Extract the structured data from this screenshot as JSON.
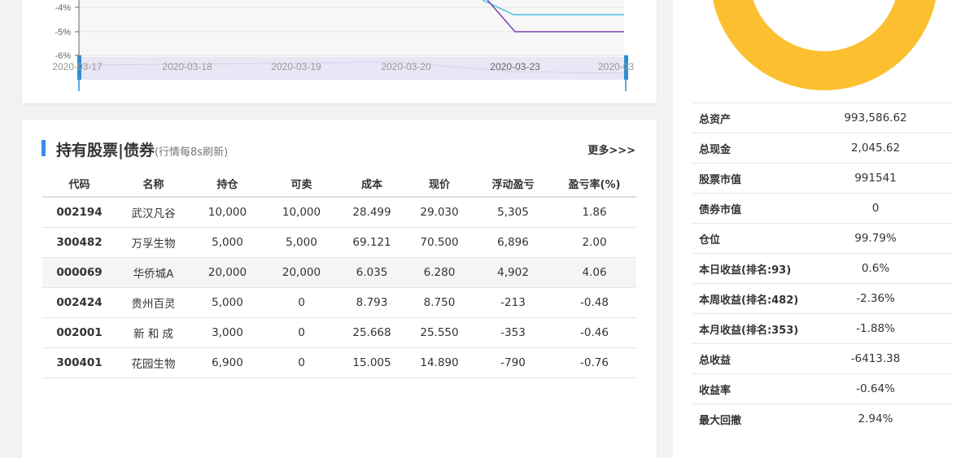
{
  "chart": {
    "y_ticks": [
      "-4%",
      "-5%",
      "-6%"
    ],
    "dates": [
      "2020-03-17",
      "2020-03-18",
      "2020-03-19",
      "2020-03-20",
      "2020-03-23",
      "2020-03"
    ],
    "colors": {
      "line_a": "#1fb8e0",
      "line_b": "#7e3fb0",
      "slider": "#e9e6f5",
      "handle": "#2a8fd4"
    }
  },
  "holdings": {
    "title": "持有股票|债券",
    "note": "(行情每8s刷新)",
    "more_label": "更多>>>",
    "columns": [
      "代码",
      "名称",
      "持仓",
      "可卖",
      "成本",
      "现价",
      "浮动盈亏",
      "盈亏率(%)"
    ],
    "rows": [
      [
        "002194",
        "武汉凡谷",
        "10,000",
        "10,000",
        "28.499",
        "29.030",
        "5,305",
        "1.86"
      ],
      [
        "300482",
        "万孚生物",
        "5,000",
        "5,000",
        "69.121",
        "70.500",
        "6,896",
        "2.00"
      ],
      [
        "000069",
        "华侨城A",
        "20,000",
        "20,000",
        "6.035",
        "6.280",
        "4,902",
        "4.06"
      ],
      [
        "002424",
        "贵州百灵",
        "5,000",
        "0",
        "8.793",
        "8.750",
        "-213",
        "-0.48"
      ],
      [
        "002001",
        "新 和 成",
        "3,000",
        "0",
        "25.668",
        "25.550",
        "-353",
        "-0.46"
      ],
      [
        "300401",
        "花园生物",
        "6,900",
        "0",
        "15.005",
        "14.890",
        "-790",
        "-0.76"
      ]
    ]
  },
  "account": {
    "donut_color": "#fbbf2f",
    "stats": [
      {
        "label": "总资产",
        "value": "993,586.62"
      },
      {
        "label": "总现金",
        "value": "2,045.62"
      },
      {
        "label": "股票市值",
        "value": "991541"
      },
      {
        "label": "债券市值",
        "value": "0"
      },
      {
        "label": "仓位",
        "value": "99.79%"
      },
      {
        "label": "本日收益(排名:93)",
        "value": "0.6%"
      },
      {
        "label": "本周收益(排名:482)",
        "value": "-2.36%"
      },
      {
        "label": "本月收益(排名:353)",
        "value": "-1.88%"
      },
      {
        "label": "总收益",
        "value": "-6413.38"
      },
      {
        "label": "收益率",
        "value": "-0.64%"
      },
      {
        "label": "最大回撤",
        "value": "2.94%"
      }
    ]
  }
}
